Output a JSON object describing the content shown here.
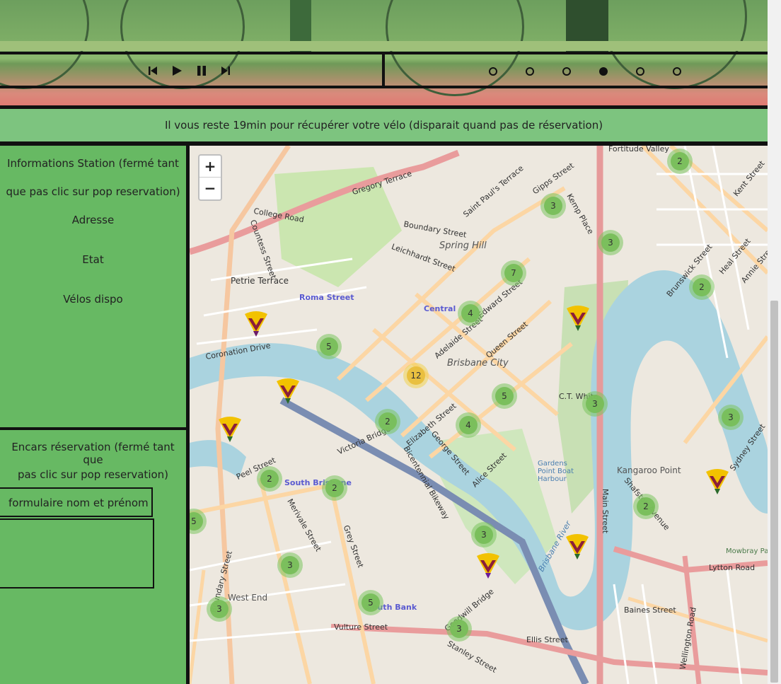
{
  "banner": {
    "message": "Il vous reste 19min pour récupérer votre vélo (disparait quand pas de réservation)"
  },
  "slider": {
    "controls": [
      "previous-icon",
      "play-icon",
      "pause-icon",
      "next-icon"
    ],
    "slide_count": 6,
    "active_slide": 4
  },
  "station_panel": {
    "title_line1": "Informations Station (fermé tant",
    "title_line2": "que pas clic sur pop reservation)",
    "address_label": "Adresse",
    "state_label": "Etat",
    "bikes_label": "Vélos dispo"
  },
  "reservation_panel": {
    "title_line1": "Encars réservation (fermé tant que",
    "title_line2": "pas clic sur pop reservation)",
    "form_label": "formulaire nom et prénom"
  },
  "map": {
    "zoom_in": "+",
    "zoom_out": "−",
    "clusters": [
      "2",
      "3",
      "3",
      "7",
      "4",
      "2",
      "5",
      "12",
      "5",
      "3",
      "2",
      "4",
      "3",
      "2",
      "2",
      "2",
      "3",
      "5",
      "2",
      "3",
      "5",
      "3",
      "3"
    ],
    "street_labels": [
      "Fortitude Valley",
      "Gregory Terrace",
      "Boundary Street",
      "Leichhardt Street",
      "Spring Hill",
      "Roma Street",
      "Central",
      "Adelaide Street",
      "Brisbane City",
      "Queen Street",
      "Elizabeth Street",
      "George Street",
      "Alice Street",
      "Main Street",
      "Kangaroo Point",
      "South Brisbane",
      "West End",
      "Vulture Street",
      "South Bank",
      "Lytton Road",
      "Baines Street",
      "Brisbane River",
      "Petrie Terrace",
      "Coronation Drive",
      "Victoria Bridge",
      "Wellington Road",
      "Boundary Street",
      "Peel Street",
      "Merivale Street",
      "Kent Street",
      "Brunswick Street",
      "College Road",
      "Countess Street",
      "Saint Paul's Terrace",
      "Edward Street",
      "Goodwill Bridge",
      "Bicentennial Bikeway",
      "Gardens Point Boat Harbour",
      "C.T. White",
      "Shafston Avenue",
      "Sydney Street",
      "Ellis Street",
      "Stanley Street",
      "Grey Street",
      "Kemp Place",
      "Gipps Street",
      "Annie Street",
      "Heal Street",
      "Mowbray Park"
    ],
    "markers": [
      "station-marker",
      "station-marker",
      "station-marker",
      "station-marker",
      "station-marker",
      "station-marker",
      "station-marker"
    ]
  }
}
